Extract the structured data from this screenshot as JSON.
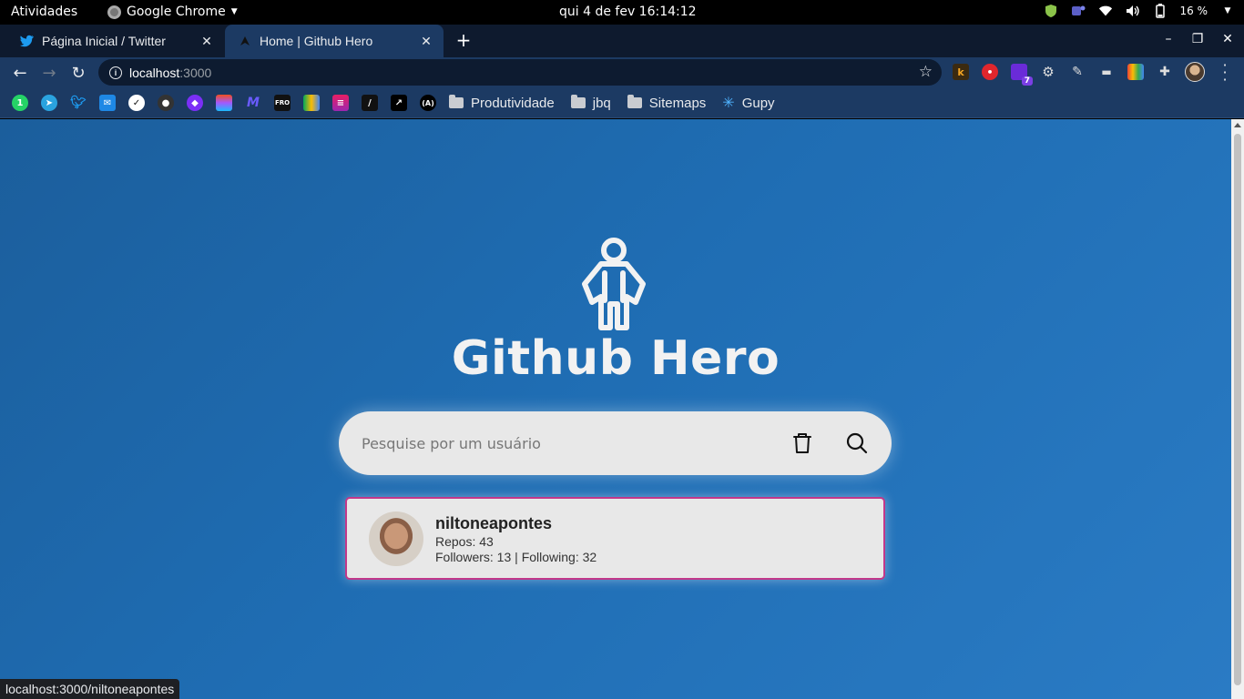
{
  "topbar": {
    "activities": "Atividades",
    "app_name": "Google Chrome",
    "clock": "qui 4 de fev  16:14:12",
    "battery": "16 %"
  },
  "tabs": [
    {
      "title": "Página Inicial / Twitter",
      "icon": "twitter-icon"
    },
    {
      "title": "Home | Github Hero",
      "icon": "github-hero-icon",
      "active": true
    }
  ],
  "address_bar": {
    "host": "localhost",
    "port": ":3000"
  },
  "bookmarks": {
    "folders": [
      "Produtividade",
      "jbq",
      "Sitemaps"
    ],
    "link": "Gupy"
  },
  "page": {
    "brand": "Github Hero",
    "search": {
      "placeholder": "Pesquise por um usuário",
      "value": ""
    },
    "result": {
      "username": "niltoneapontes",
      "repos": "Repos: 43",
      "followers": "Followers: 13",
      "separator": " | ",
      "following": "Following: 32"
    }
  },
  "status_url": "localhost:3000/niltoneapontes",
  "colors": {
    "page_gradient_start": "#1b5e9c",
    "page_gradient_end": "#2a7bc4",
    "card_border": "#c2378a",
    "chrome_frame": "#1c3a63"
  }
}
